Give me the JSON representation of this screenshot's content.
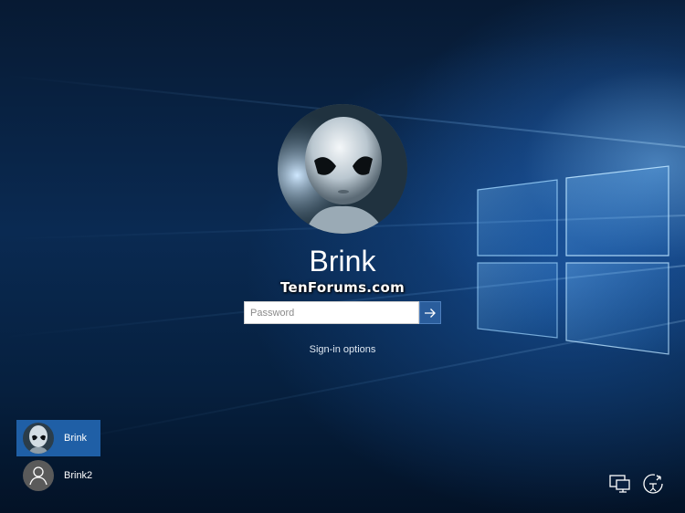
{
  "lockscreen": {
    "user_name": "Brink",
    "watermark": "TenForums.com",
    "password_placeholder": "Password",
    "signin_options_label": "Sign-in options"
  },
  "users": [
    {
      "name": "Brink",
      "avatar": "alien-avatar",
      "selected": true
    },
    {
      "name": "Brink2",
      "avatar": "default-person-icon",
      "selected": false
    }
  ],
  "tray": {
    "network_icon": "network-icon",
    "ease_of_access_icon": "ease-of-access-icon"
  },
  "colors": {
    "selected_user_tile": "#1f5fa6",
    "submit_button": "#2a5d9c"
  }
}
